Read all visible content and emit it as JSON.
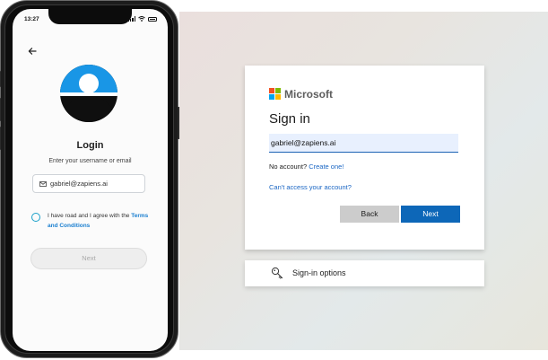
{
  "phone": {
    "status_time": "13:27",
    "title": "Login",
    "subtitle": "Enter your username or email",
    "email_value": "gabriel@zapiens.ai",
    "agree_text": "I have road and I agree with the ",
    "terms_link": "Terms and Conditions",
    "next_label": "Next",
    "colors": {
      "accent": "#1996e6",
      "link": "#1a7fd0",
      "disabled_button": "#eeeeee"
    }
  },
  "microsoft": {
    "brand": "Microsoft",
    "title": "Sign in",
    "email_value": "gabriel@zapiens.ai",
    "no_account_text": "No account? ",
    "create_link": "Create one!",
    "cant_access_link": "Can't access your account?",
    "back_label": "Back",
    "next_label": "Next",
    "signin_options_label": "Sign-in options",
    "colors": {
      "primary": "#0d67b8",
      "link": "#1a66c4",
      "logo": [
        "#f25022",
        "#7fba00",
        "#00a4ef",
        "#ffb900"
      ]
    }
  }
}
